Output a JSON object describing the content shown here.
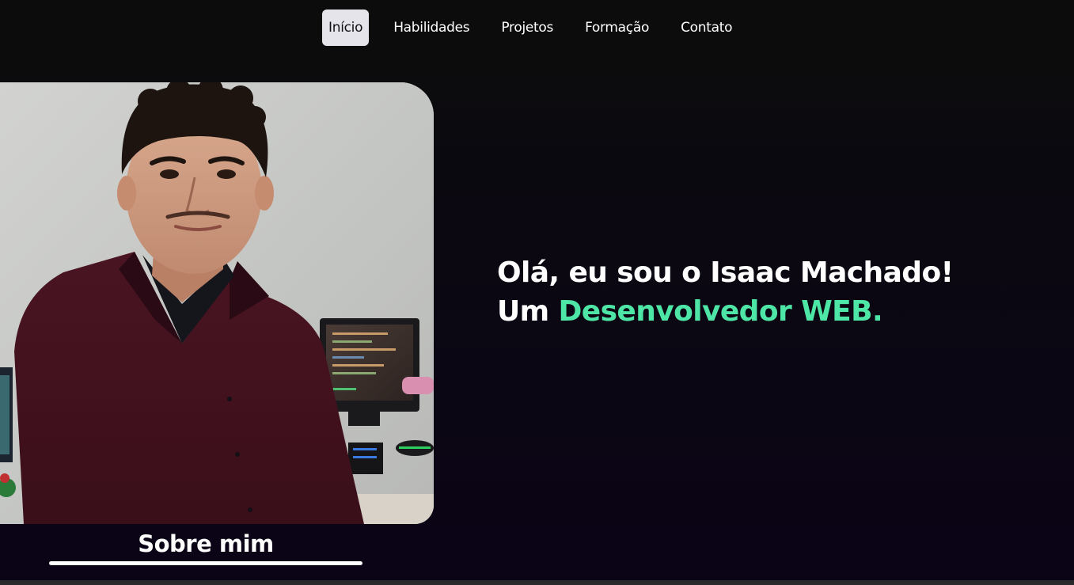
{
  "nav": {
    "items": [
      {
        "label": "Início",
        "active": true
      },
      {
        "label": "Habilidades",
        "active": false
      },
      {
        "label": "Projetos",
        "active": false
      },
      {
        "label": "Formação",
        "active": false
      },
      {
        "label": "Contato",
        "active": false
      }
    ]
  },
  "hero": {
    "line1": "Olá, eu sou o Isaac Machado!",
    "line2_prefix": "Um ",
    "line2_accent": "Desenvolvedor WEB."
  },
  "about": {
    "label": "Sobre mim"
  },
  "colors": {
    "accent": "#4ee6a6",
    "background": "#0c0c0c",
    "nav_active_bg": "#e4e4ea"
  }
}
